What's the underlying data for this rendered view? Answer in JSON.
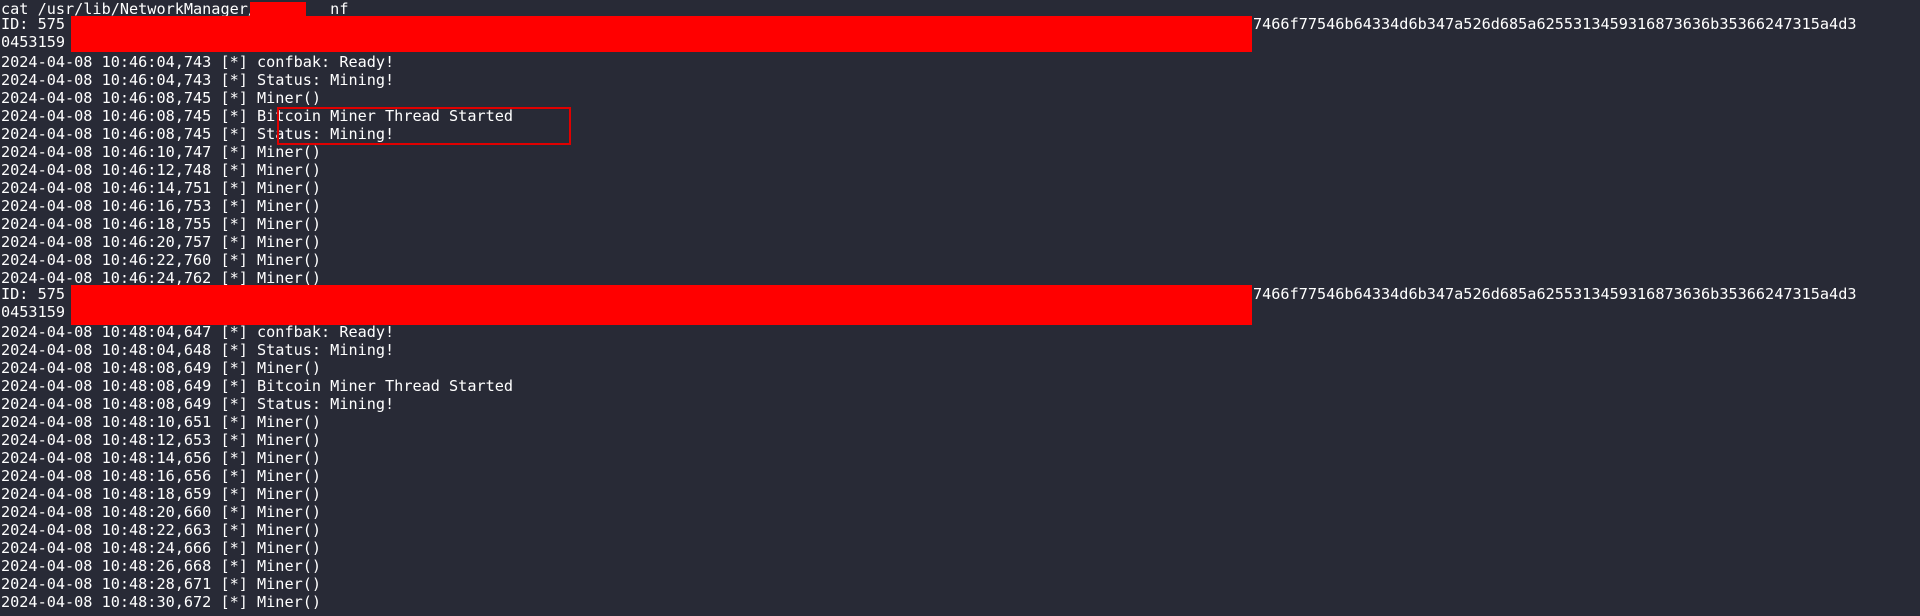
{
  "terminal": {
    "command": "cat /usr/lib/NetworkManager/in      nf",
    "block1": {
      "id_prefix": "ID: 575",
      "id_suffix": "7466f77546b64334d6b347a526d685a6255313459316873636b35366247315a4d3",
      "id_cont": "0453159",
      "lines": [
        "2024-04-08 10:46:04,743 [*] confbak: Ready!",
        "2024-04-08 10:46:04,743 [*] Status: Mining!",
        "2024-04-08 10:46:08,745 [*] Miner()",
        "2024-04-08 10:46:08,745 [*] Bitcoin Miner Thread Started",
        "2024-04-08 10:46:08,745 [*] Status: Mining!",
        "2024-04-08 10:46:10,747 [*] Miner()",
        "2024-04-08 10:46:12,748 [*] Miner()",
        "2024-04-08 10:46:14,751 [*] Miner()",
        "2024-04-08 10:46:16,753 [*] Miner()",
        "2024-04-08 10:46:18,755 [*] Miner()",
        "2024-04-08 10:46:20,757 [*] Miner()",
        "2024-04-08 10:46:22,760 [*] Miner()",
        "2024-04-08 10:46:24,762 [*] Miner()"
      ]
    },
    "block2": {
      "id_prefix": "ID: 575",
      "id_suffix": "7466f77546b64334d6b347a526d685a6255313459316873636b35366247315a4d3",
      "id_cont": "0453159",
      "lines": [
        "2024-04-08 10:48:04,647 [*] confbak: Ready!",
        "2024-04-08 10:48:04,648 [*] Status: Mining!",
        "2024-04-08 10:48:08,649 [*] Miner()",
        "2024-04-08 10:48:08,649 [*] Bitcoin Miner Thread Started",
        "2024-04-08 10:48:08,649 [*] Status: Mining!",
        "2024-04-08 10:48:10,651 [*] Miner()",
        "2024-04-08 10:48:12,653 [*] Miner()",
        "2024-04-08 10:48:14,656 [*] Miner()",
        "2024-04-08 10:48:16,656 [*] Miner()",
        "2024-04-08 10:48:18,659 [*] Miner()",
        "2024-04-08 10:48:20,660 [*] Miner()",
        "2024-04-08 10:48:22,663 [*] Miner()",
        "2024-04-08 10:48:24,666 [*] Miner()",
        "2024-04-08 10:48:26,668 [*] Miner()",
        "2024-04-08 10:48:28,671 [*] Miner()",
        "2024-04-08 10:48:30,672 [*] Miner()"
      ]
    },
    "colors": {
      "background": "#282a36",
      "text": "#ffffff",
      "redaction": "#ff0000",
      "highlight_border": "#e00000"
    }
  }
}
